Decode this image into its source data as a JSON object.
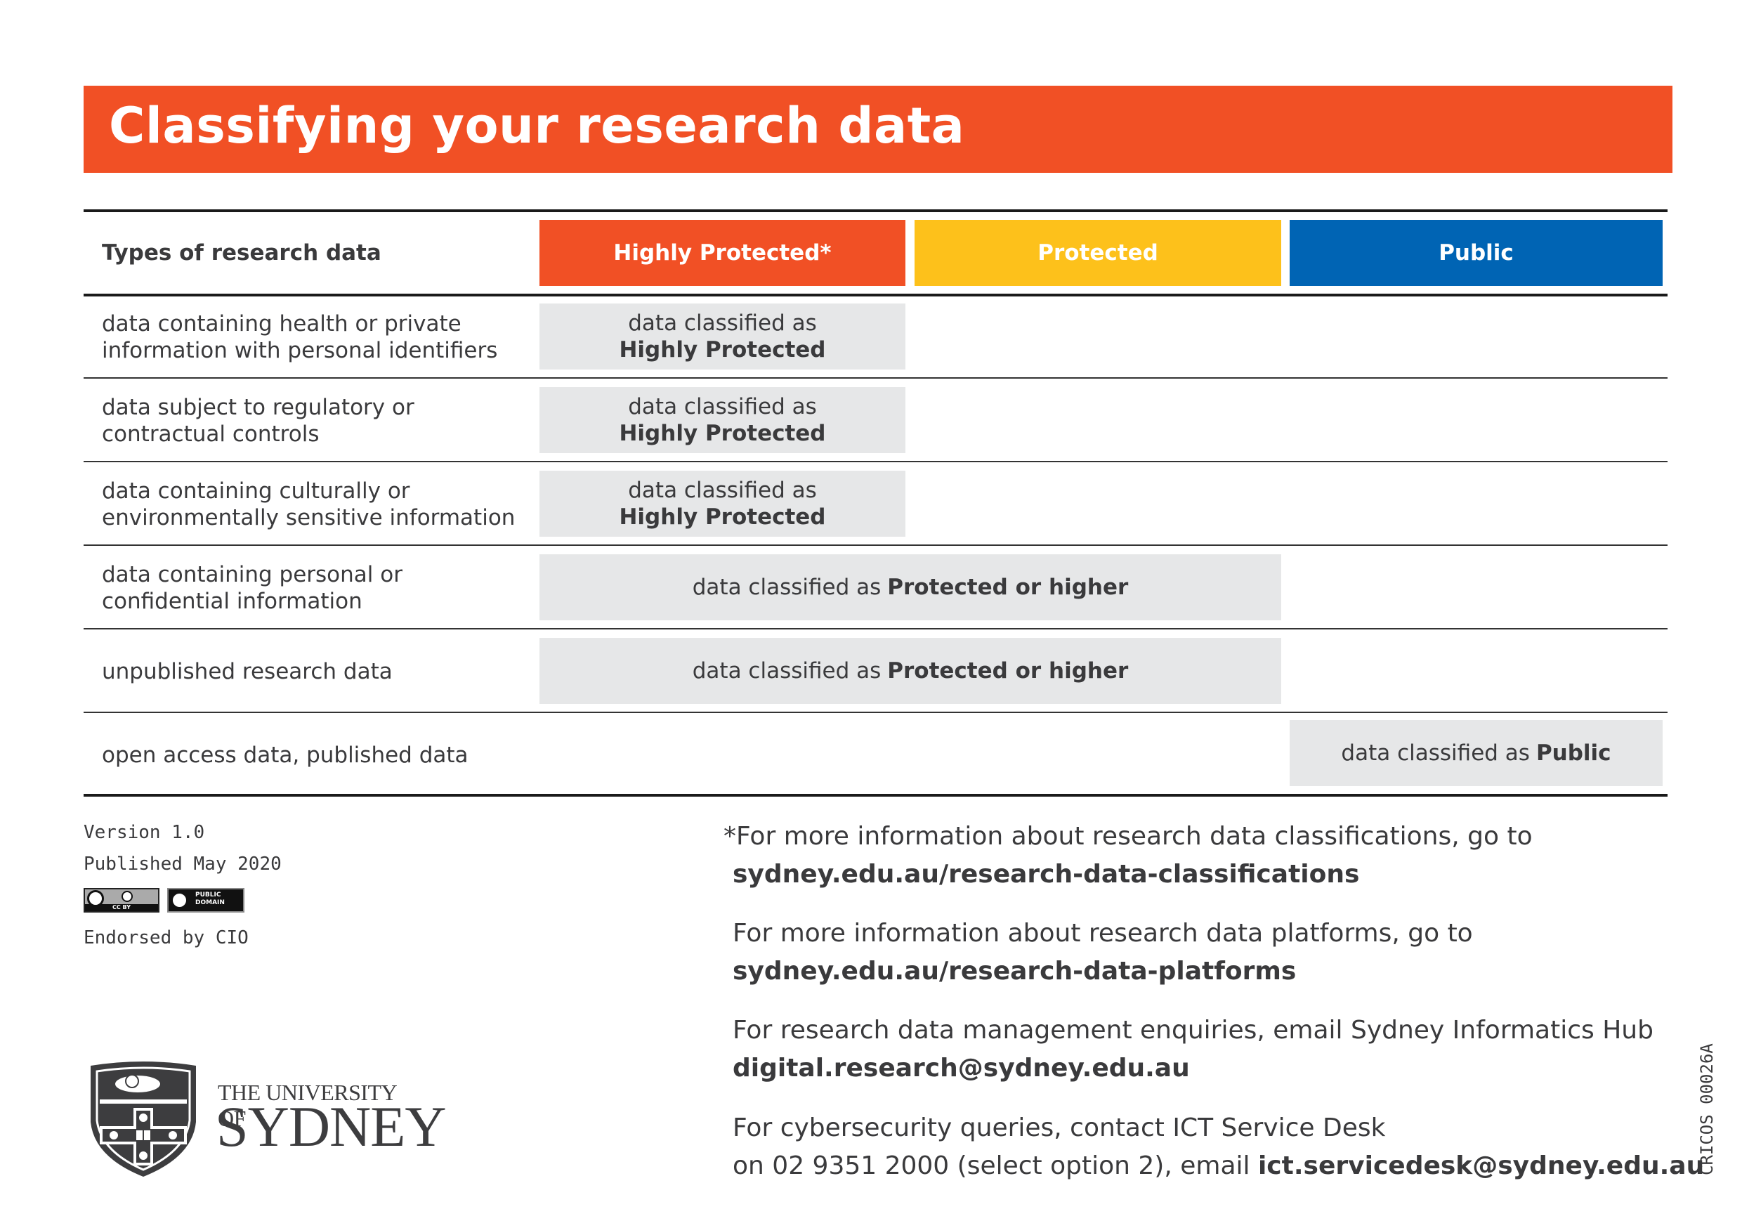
{
  "title": "Classifying your research data",
  "colors": {
    "highly_protected": "#f15025",
    "protected": "#fdc11b",
    "public": "#0064b4",
    "cell_gray": "#e6e7e8"
  },
  "table": {
    "header": {
      "types_label": "Types of research data",
      "columns": [
        "Highly Protected*",
        "Protected",
        "Public"
      ]
    },
    "rows": [
      {
        "label": "data containing health or private information with personal identifiers",
        "cell_prefix": "data classified as",
        "cell_value": "Highly Protected",
        "span": "highly_protected"
      },
      {
        "label": "data subject to regulatory or contractual controls",
        "cell_prefix": "data classified as",
        "cell_value": "Highly Protected",
        "span": "highly_protected"
      },
      {
        "label": "data containing culturally or environmentally sensitive information",
        "cell_prefix": "data classified as",
        "cell_value": "Highly Protected",
        "span": "highly_protected"
      },
      {
        "label": "data containing personal or confidential information",
        "cell_prefix": "data classified as",
        "cell_value": "Protected or higher",
        "span": "highly_protected+protected"
      },
      {
        "label": "unpublished research data",
        "cell_prefix": "data classified as",
        "cell_value": "Protected or higher",
        "span": "highly_protected+protected"
      },
      {
        "label": "open access data, published data",
        "cell_prefix": "data classified as",
        "cell_value": "Public",
        "span": "public"
      }
    ]
  },
  "meta": {
    "version": "Version 1.0",
    "published": "Published May 2020",
    "endorsed": "Endorsed by CIO",
    "license_badges": [
      "CC BY",
      "PUBLIC DOMAIN"
    ],
    "cricos": "CRICOS 00026A"
  },
  "logo": {
    "line1": "THE UNIVERSITY OF",
    "line2": "SYDNEY"
  },
  "footer": [
    {
      "text": "*For more information about research data classifications, go to",
      "link": "sydney.edu.au/research-data-classifications"
    },
    {
      "text": "For more information about research data platforms, go to",
      "link": "sydney.edu.au/research-data-platforms"
    },
    {
      "text": "For research data management enquiries, email Sydney Informatics Hub",
      "link": "digital.research@sydney.edu.au"
    },
    {
      "text": "For cybersecurity queries, contact ICT Service Desk",
      "text2": "on 02 9351 2000 (select option 2), email",
      "link": "ict.servicedesk@sydney.edu.au"
    }
  ]
}
